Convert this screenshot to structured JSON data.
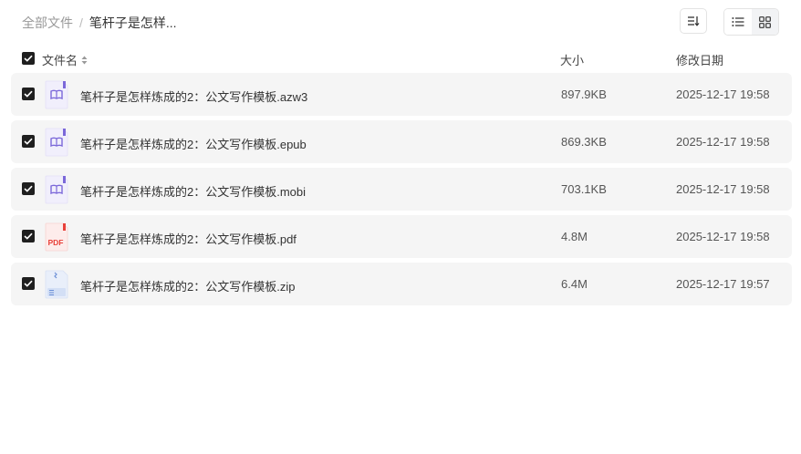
{
  "breadcrumb": {
    "root": "全部文件",
    "separator": "/",
    "current": "笔杆子是怎样..."
  },
  "toolbar": {
    "sort_icon": "sort-icon",
    "list_view_icon": "list-view-icon",
    "grid_view_icon": "grid-view-icon"
  },
  "header": {
    "name": "文件名",
    "size": "大小",
    "date": "修改日期"
  },
  "files": [
    {
      "name": "笔杆子是怎样炼成的2：公文写作模板.azw3",
      "size": "897.9KB",
      "date": "2025-12-17 19:58",
      "icon": "ebook-icon",
      "checked": true
    },
    {
      "name": "笔杆子是怎样炼成的2：公文写作模板.epub",
      "size": "869.3KB",
      "date": "2025-12-17 19:58",
      "icon": "ebook-icon",
      "checked": true
    },
    {
      "name": "笔杆子是怎样炼成的2：公文写作模板.mobi",
      "size": "703.1KB",
      "date": "2025-12-17 19:58",
      "icon": "ebook-icon",
      "checked": true
    },
    {
      "name": "笔杆子是怎样炼成的2：公文写作模板.pdf",
      "size": "4.8M",
      "date": "2025-12-17 19:58",
      "icon": "pdf-icon",
      "checked": true
    },
    {
      "name": "笔杆子是怎样炼成的2：公文写作模板.zip",
      "size": "6.4M",
      "date": "2025-12-17 19:57",
      "icon": "zip-icon",
      "checked": true
    }
  ],
  "pdf_icon_label": "PDF",
  "colors": {
    "row_bg": "#f5f5f5",
    "checkbox": "#1f1f1f",
    "ebook_accent": "#7b68d9",
    "pdf_red": "#e8413a",
    "zip_blue": "#6b8fd6"
  }
}
